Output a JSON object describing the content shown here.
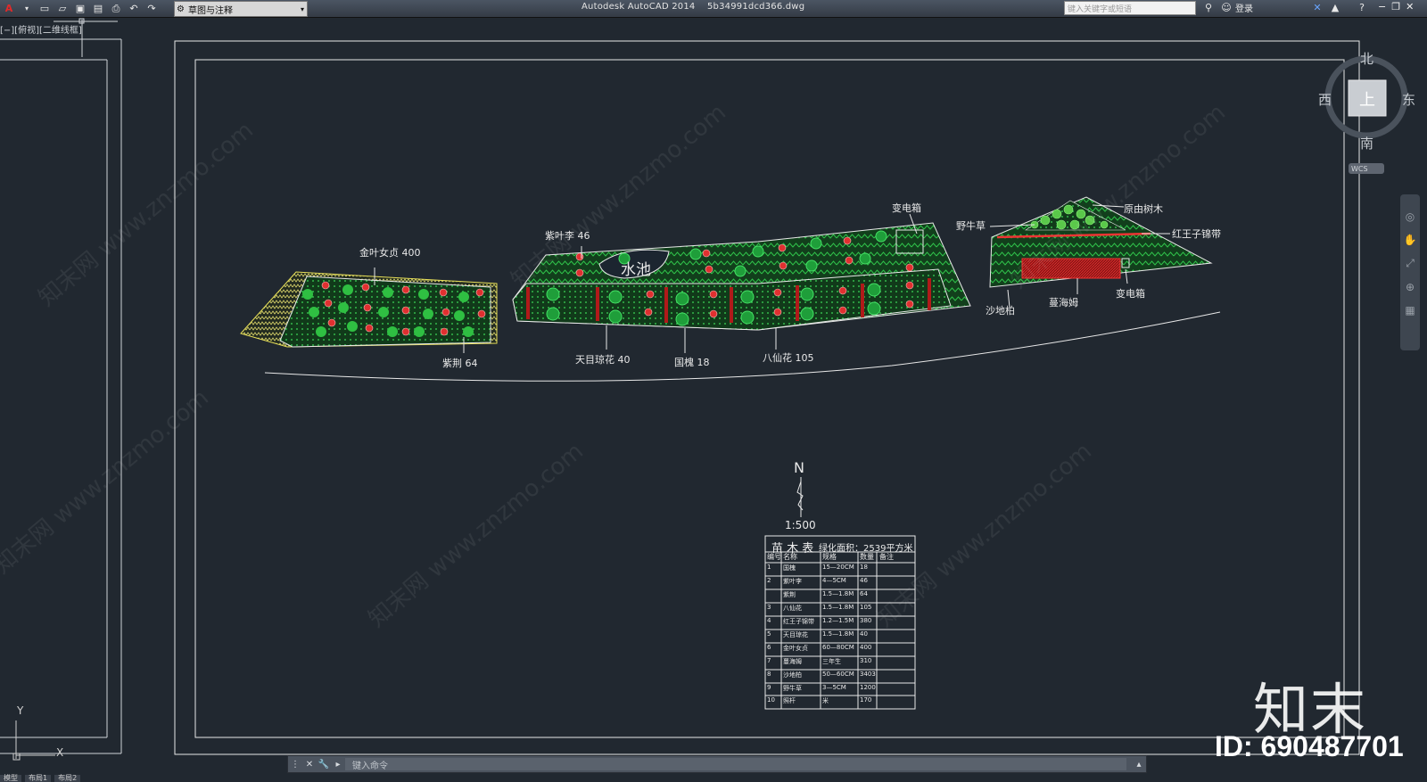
{
  "titlebar": {
    "app_title": "Autodesk AutoCAD 2014",
    "filename": "5b34991dcd366.dwg",
    "workspace": "草图与注释",
    "search_placeholder": "键入关键字或短语",
    "login_label": "登录"
  },
  "viewport": {
    "label": "[−][俯视][二维线框]"
  },
  "plan_labels": {
    "jinye": "金叶女贞 400",
    "zijing": "紫荆 64",
    "ziyeli": "紫叶李 46",
    "shuichi": "水池",
    "tianmu": "天目琼花 40",
    "guohuai": "国槐 18",
    "baxian": "八仙花 105",
    "biandianxiang1": "变电箱",
    "yeniucao": "野牛草",
    "yuanyou": "原由树木",
    "hongwangzi": "红王子锦带",
    "shadibai": "沙地柏",
    "manhaimu": "蔓海姆",
    "biandianxiang2": "变电箱"
  },
  "north_arrow": {
    "letter": "N",
    "scale": "1:500"
  },
  "compass": {
    "north": "北",
    "south": "南",
    "west": "西",
    "east": "东",
    "center": "上",
    "wcs": "WCS"
  },
  "plant_table": {
    "title": "苗  木  表",
    "area_note": "绿化面积：2539平方米",
    "headers": [
      "编号",
      "名称",
      "规格",
      "数量",
      "备注"
    ],
    "rows": [
      [
        "1",
        "国槐",
        "15—20CM",
        "18",
        ""
      ],
      [
        "2",
        "紫叶李",
        "4—5CM",
        "46",
        ""
      ],
      [
        "",
        "紫荆",
        "1.5—1.8M",
        "64",
        ""
      ],
      [
        "3",
        "八仙花",
        "1.5—1.8M",
        "105",
        ""
      ],
      [
        "4",
        "红王子锦带",
        "1.2—1.5M",
        "380",
        ""
      ],
      [
        "5",
        "天目琼花",
        "1.5—1.8M",
        "40",
        ""
      ],
      [
        "6",
        "金叶女贞",
        "60—80CM",
        "400",
        ""
      ],
      [
        "7",
        "蔓海姆",
        "三年生",
        "310",
        ""
      ],
      [
        "8",
        "沙地柏",
        "50—60CM",
        "3403",
        ""
      ],
      [
        "9",
        "野牛草",
        "3—5CM",
        "1200",
        ""
      ],
      [
        "10",
        "照杆",
        "米",
        "170",
        ""
      ]
    ]
  },
  "command_line": {
    "placeholder": "键入命令"
  },
  "layout_tabs": [
    "模型",
    "布局1",
    "布局2"
  ],
  "axis": {
    "x": "X",
    "y": "Y"
  },
  "watermark": {
    "text": "知末网 www.znzmo.com",
    "brand": "知末",
    "id": "ID: 690487701"
  },
  "colors": {
    "canvas": "#212830",
    "hatch_green": "#1a6b2a",
    "line_white": "#e8e8e8",
    "flower_red": "#e03030",
    "yellow": "#e8e05a"
  }
}
